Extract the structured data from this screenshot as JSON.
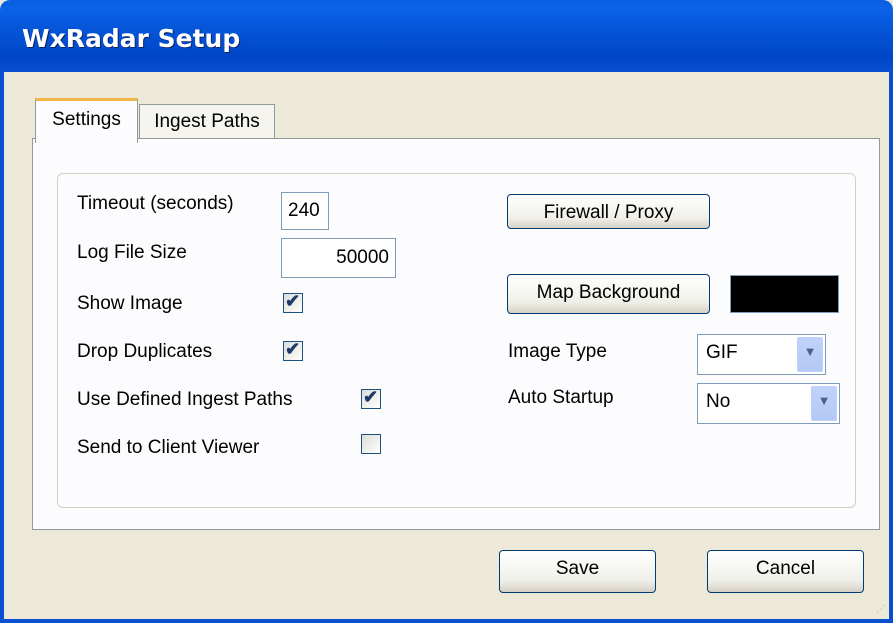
{
  "window": {
    "title": "WxRadar Setup"
  },
  "tabs": [
    {
      "label": "Settings",
      "active": true
    },
    {
      "label": "Ingest Paths",
      "active": false
    }
  ],
  "settings": {
    "timeout": {
      "label": "Timeout (seconds)",
      "value": "240"
    },
    "log_file_size": {
      "label": "Log File Size",
      "value": "50000"
    },
    "show_image": {
      "label": "Show Image",
      "checked": true
    },
    "drop_duplicates": {
      "label": "Drop Duplicates",
      "checked": true
    },
    "use_defined_ingest_paths": {
      "label": "Use Defined Ingest Paths",
      "checked": true
    },
    "send_to_client_viewer": {
      "label": "Send to Client Viewer",
      "checked": false
    },
    "firewall_proxy_button": "Firewall / Proxy",
    "map_background_button": "Map Background",
    "map_background_color": "#000000",
    "image_type": {
      "label": "Image Type",
      "value": "GIF"
    },
    "auto_startup": {
      "label": "Auto Startup",
      "value": "No"
    }
  },
  "footer": {
    "save_label": "Save",
    "cancel_label": "Cancel"
  },
  "colors": {
    "titlebar": "#0553d6",
    "check": "#21a121",
    "dialog_bg": "#ece9d8"
  }
}
